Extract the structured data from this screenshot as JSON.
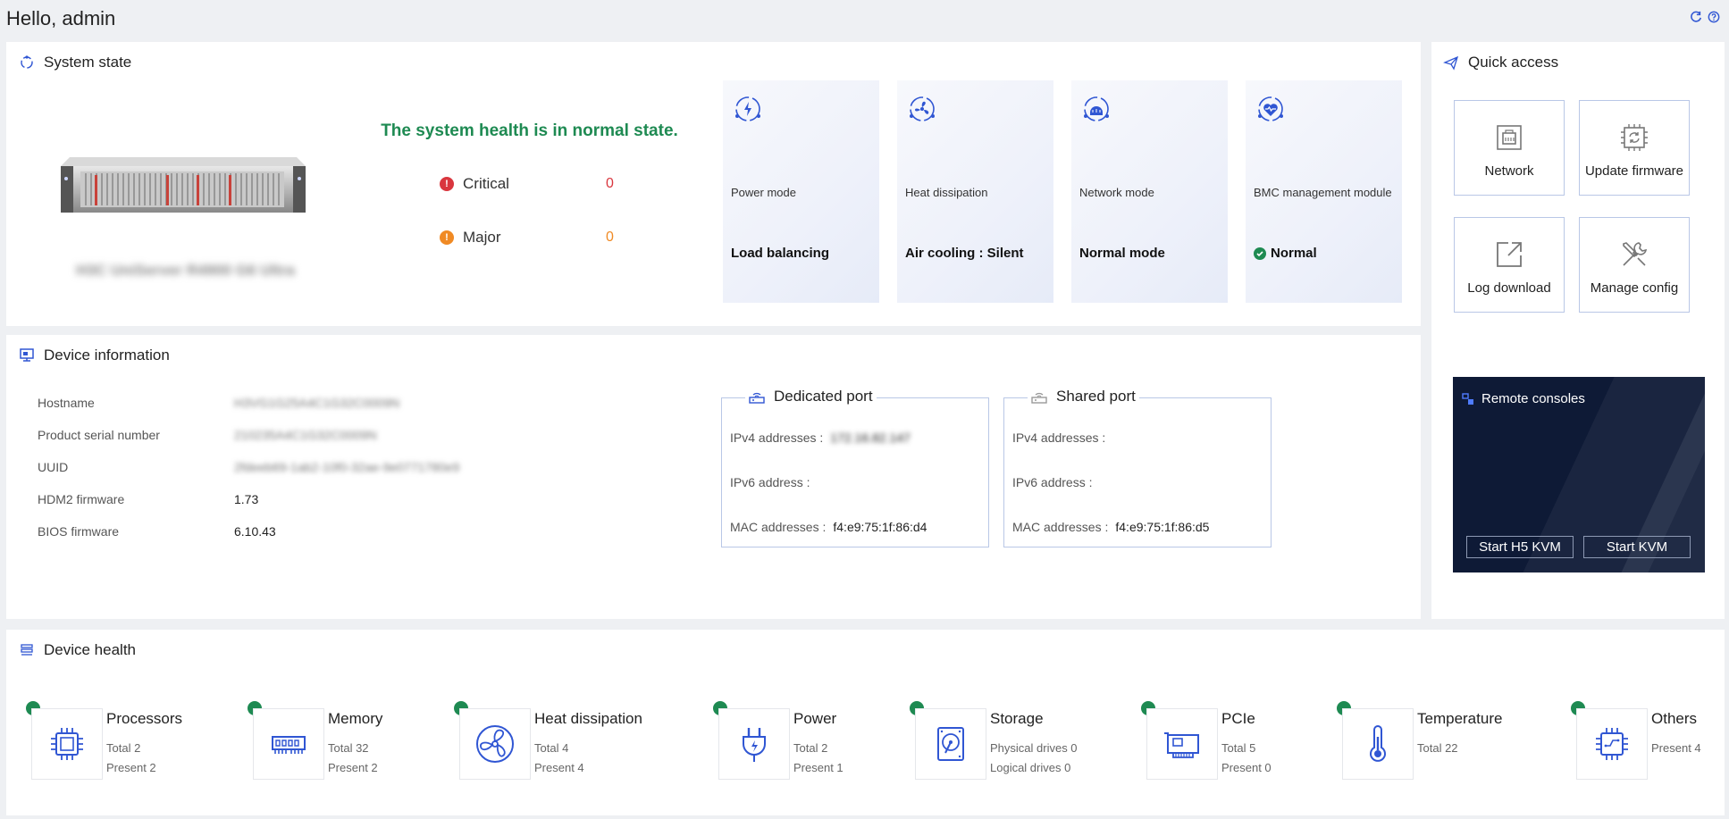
{
  "header": {
    "greeting": "Hello, admin",
    "icons": [
      "refresh-icon",
      "help-icon"
    ]
  },
  "system_state": {
    "title": "System state",
    "server_name": "H3C UniServer R4900 G6 Ultra",
    "health_message": "The system health is in normal state.",
    "alarms": [
      {
        "label": "Critical",
        "count": "0",
        "color": "#d9363e"
      },
      {
        "label": "Major",
        "count": "0",
        "color": "#f08a24"
      }
    ],
    "cards": [
      {
        "icon": "power-mode-icon",
        "label": "Power mode",
        "value": "Load balancing",
        "status_icon": false
      },
      {
        "icon": "fan-icon",
        "label": "Heat dissipation",
        "value": "Air cooling : Silent",
        "status_icon": false
      },
      {
        "icon": "network-mode-icon",
        "label": "Network mode",
        "value": "Normal mode",
        "status_icon": false
      },
      {
        "icon": "bmc-heart-icon",
        "label": "BMC management module",
        "value": "Normal",
        "status_icon": true
      }
    ]
  },
  "quick_access": {
    "title": "Quick access",
    "buttons": [
      {
        "label": "Network",
        "icon": "network-port-icon"
      },
      {
        "label": "Update firmware",
        "icon": "update-chip-icon"
      },
      {
        "label": "Log download",
        "icon": "external-link-icon"
      },
      {
        "label": "Manage config",
        "icon": "tools-icon"
      }
    ],
    "remote": {
      "title": "Remote consoles",
      "h5_kvm": "Start H5 KVM",
      "kvm": "Start KVM"
    }
  },
  "device_info": {
    "title": "Device information",
    "rows": [
      {
        "label": "Hostname",
        "value": "H3VG1G25A4C1G32C0009N",
        "blurred": true
      },
      {
        "label": "Product serial number",
        "value": "210235A4C1G32C0009N",
        "blurred": true
      },
      {
        "label": "UUID",
        "value": "2fdeeb69-1ab2-10f0-32ae-9e0771780e9",
        "blurred": true
      },
      {
        "label": "HDM2 firmware",
        "value": "1.73",
        "blurred": false
      },
      {
        "label": "BIOS firmware",
        "value": "6.10.43",
        "blurred": false
      }
    ],
    "dedicated_port": {
      "title": "Dedicated port",
      "ipv4_label": "IPv4 addresses :",
      "ipv4_value": "172.16.82.147",
      "ipv6_label": "IPv6 address :",
      "ipv6_value": "",
      "mac_label": "MAC addresses :",
      "mac_value": "f4:e9:75:1f:86:d4"
    },
    "shared_port": {
      "title": "Shared port",
      "ipv4_label": "IPv4 addresses :",
      "ipv4_value": "",
      "ipv6_label": "IPv6 address :",
      "ipv6_value": "",
      "mac_label": "MAC addresses :",
      "mac_value": "f4:e9:75:1f:86:d5"
    }
  },
  "device_health": {
    "title": "Device health",
    "items": [
      {
        "name": "Processors",
        "icon": "cpu-icon",
        "lines": [
          "Total 2",
          "Present 2"
        ]
      },
      {
        "name": "Memory",
        "icon": "memory-icon",
        "lines": [
          "Total 32",
          "Present 2"
        ]
      },
      {
        "name": "Heat dissipation",
        "icon": "fan-icon",
        "lines": [
          "Total 4",
          "Present 4"
        ]
      },
      {
        "name": "Power",
        "icon": "power-plug-icon",
        "lines": [
          "Total 2",
          "Present 1"
        ]
      },
      {
        "name": "Storage",
        "icon": "hard-drive-icon",
        "lines": [
          "Physical drives 0",
          "Logical drives 0"
        ]
      },
      {
        "name": "PCIe",
        "icon": "pcie-card-icon",
        "lines": [
          "Total 5",
          "Present 0"
        ]
      },
      {
        "name": "Temperature",
        "icon": "thermometer-icon",
        "lines": [
          "Total 22"
        ]
      },
      {
        "name": "Others",
        "icon": "chip-icon",
        "lines": [
          "Present 4"
        ]
      }
    ]
  },
  "colors": {
    "accent": "#3056d3",
    "healthy": "#1e8a52",
    "remote_bg": "#0e1a36"
  }
}
